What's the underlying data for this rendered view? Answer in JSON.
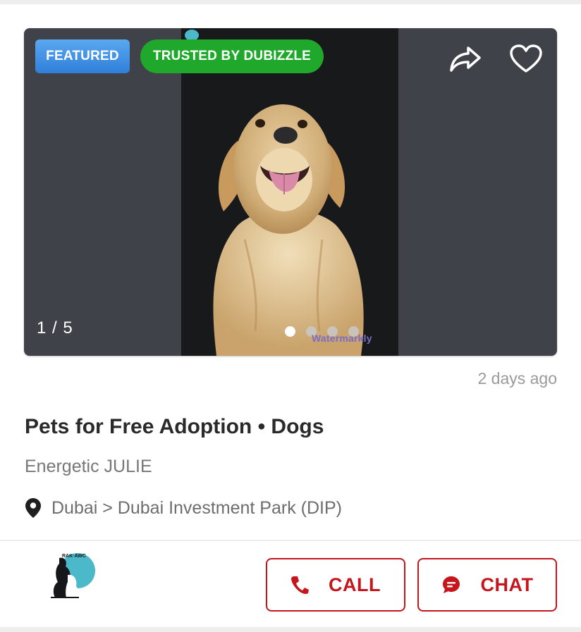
{
  "listing": {
    "badges": {
      "featured": "FEATURED",
      "trusted": "TRUSTED BY DUBIZZLE"
    },
    "gallery": {
      "counter": "1 / 5",
      "dot_count": 4,
      "active_dot": 0,
      "watermark_text": "Watermarkly"
    },
    "posted": "2 days ago",
    "title": "Pets for Free Adoption • Dogs",
    "subtitle": "Energetic JULIE",
    "location": "Dubai > Dubai Investment Park (DIP)"
  },
  "seller": {
    "logo_text": "RAK AWC"
  },
  "actions": {
    "call_label": "CALL",
    "chat_label": "CHAT"
  },
  "icons": {
    "share": "share-icon",
    "favorite": "heart-icon",
    "location": "location-pin-icon",
    "phone": "phone-icon",
    "chat": "chat-bubble-icon"
  },
  "colors": {
    "accent_red": "#c4161c",
    "featured_blue": "#3a8ce3",
    "trusted_green": "#1fa82c",
    "card_bg": "#3f4349"
  }
}
